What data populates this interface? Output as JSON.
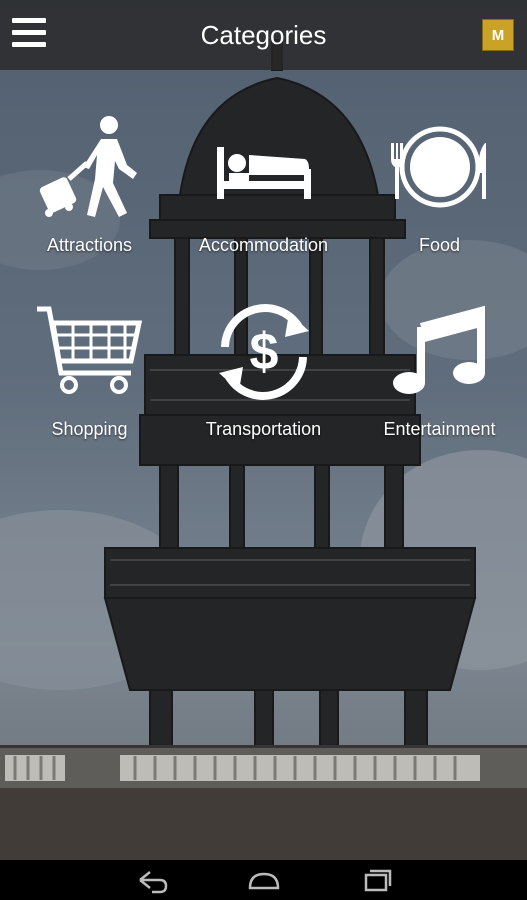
{
  "header": {
    "title": "Categories",
    "badge_letter": "M",
    "menu_icon": "hamburger-menu-icon"
  },
  "categories": [
    {
      "label": "Attractions",
      "icon": "traveler-with-luggage-icon"
    },
    {
      "label": "Accommodation",
      "icon": "bed-icon"
    },
    {
      "label": "Food",
      "icon": "plate-fork-knife-icon"
    },
    {
      "label": "Shopping",
      "icon": "shopping-cart-icon"
    },
    {
      "label": "Transportation",
      "icon": "currency-exchange-icon"
    },
    {
      "label": "Entertainment",
      "icon": "music-note-icon"
    }
  ],
  "nav": {
    "back_icon": "back-icon",
    "home_icon": "home-icon",
    "recents_icon": "recent-apps-icon"
  },
  "colors": {
    "accent_badge": "#c9a227",
    "topbar": "#282828",
    "icon_color": "#ffffff"
  }
}
